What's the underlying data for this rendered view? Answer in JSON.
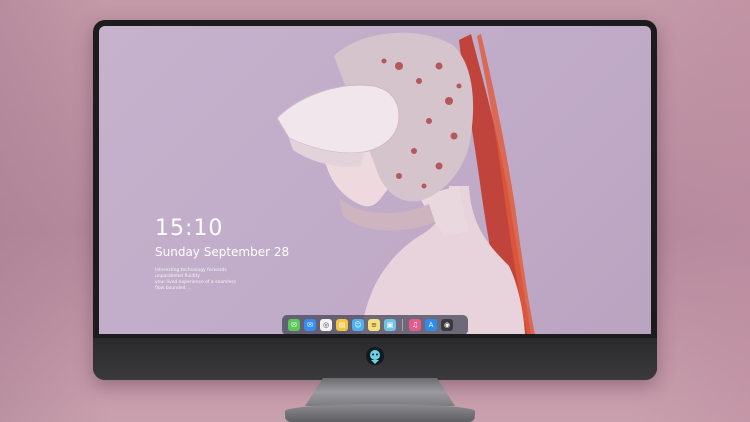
{
  "lock_screen": {
    "time": "15:10",
    "date": "Sunday September 28",
    "caption_line1": "Interesting technology forwards unparalleled fluidity",
    "caption_line2": "your lived experience of a seamless flow bounded ..."
  },
  "dock": {
    "apps": [
      {
        "name": "messages-icon",
        "color": "#5dc85a",
        "glyph": "✉"
      },
      {
        "name": "mail-icon",
        "color": "#3b8cf0",
        "glyph": "✉"
      },
      {
        "name": "safari-icon",
        "color": "#f2f2f2",
        "glyph": "◎"
      },
      {
        "name": "files-icon",
        "color": "#f4c542",
        "glyph": "▤"
      },
      {
        "name": "finder-icon",
        "color": "#4db1f0",
        "glyph": "☺"
      },
      {
        "name": "notes-icon",
        "color": "#f7e27a",
        "glyph": "≡"
      },
      {
        "name": "photos-icon",
        "color": "#6fc2e8",
        "glyph": "▣"
      },
      {
        "name": "music-icon",
        "color": "#e85a8c",
        "glyph": "♫"
      },
      {
        "name": "app-store-icon",
        "color": "#2d8cf0",
        "glyph": "A"
      },
      {
        "name": "camera-icon",
        "color": "#3a3a3c",
        "glyph": "◉"
      }
    ]
  },
  "colors": {
    "bezel": "#1c1c1e",
    "wallpaper": "#c1adc9",
    "accent_red": "#c0392b"
  }
}
